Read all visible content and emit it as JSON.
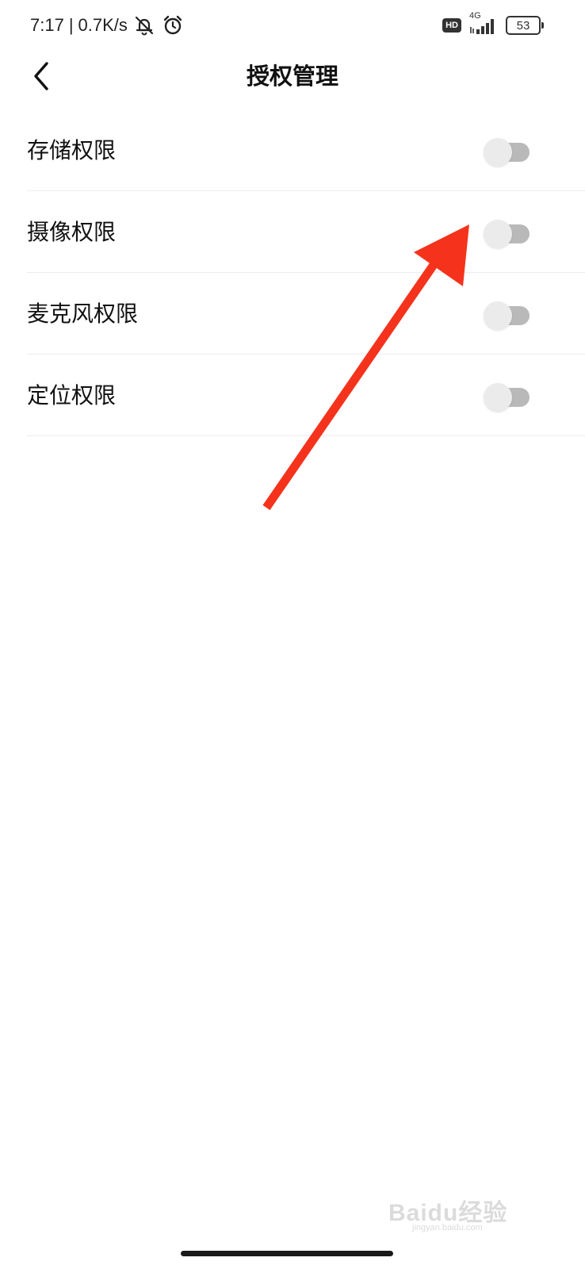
{
  "status_bar": {
    "time": "7:17",
    "separator": "|",
    "net_speed": "0.7K/s",
    "hd_badge": "HD",
    "network_type": "4G",
    "battery": "53",
    "icons": [
      "mute-bell-icon",
      "alarm-clock-icon",
      "signal-icon",
      "battery-icon"
    ]
  },
  "header": {
    "title": "授权管理",
    "back_icon": "chevron-left-icon"
  },
  "permissions": [
    {
      "label": "存储权限",
      "enabled": false
    },
    {
      "label": "摄像权限",
      "enabled": false
    },
    {
      "label": "麦克风权限",
      "enabled": false
    },
    {
      "label": "定位权限",
      "enabled": false
    }
  ],
  "annotation": {
    "type": "arrow",
    "color": "#f5331c",
    "points_to": "摄像权限"
  },
  "watermark": {
    "text": "Baidu经验",
    "sub": "jingyan.baidu.com"
  }
}
